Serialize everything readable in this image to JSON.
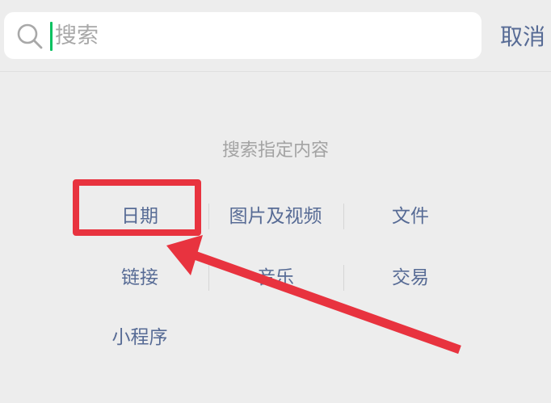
{
  "search": {
    "placeholder": "搜索",
    "value": "",
    "cancel_label": "取消"
  },
  "section": {
    "title": "搜索指定内容"
  },
  "options": [
    {
      "label": "日期"
    },
    {
      "label": "图片及视频"
    },
    {
      "label": "文件"
    },
    {
      "label": "链接"
    },
    {
      "label": "音乐"
    },
    {
      "label": "交易"
    },
    {
      "label": "小程序"
    }
  ],
  "annotation": {
    "color": "#e8333f"
  },
  "colors": {
    "link": "#576b95",
    "caret": "#07c160",
    "background": "#ededed"
  }
}
